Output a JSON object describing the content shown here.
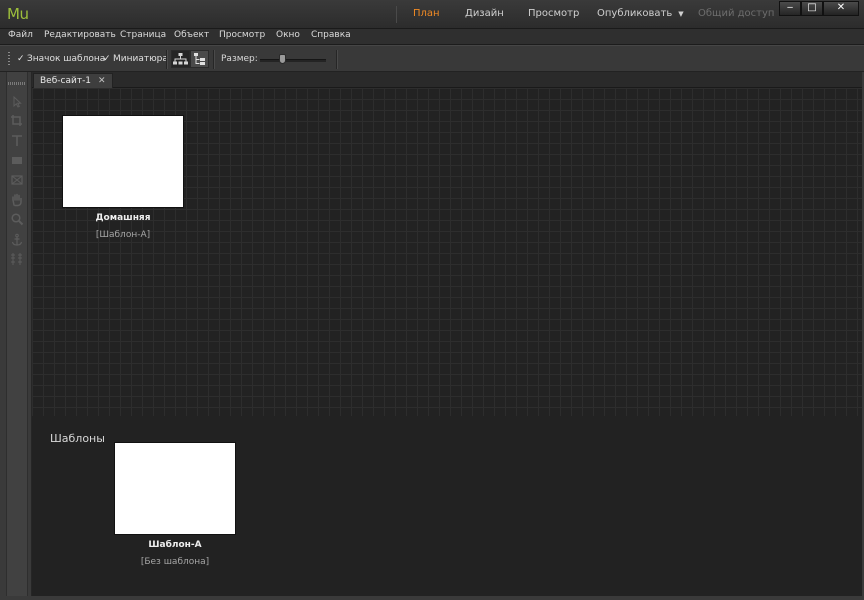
{
  "app": {
    "logo": "Mu"
  },
  "modes": [
    {
      "label": "План",
      "state": "active"
    },
    {
      "label": "Дизайн",
      "state": "normal"
    },
    {
      "label": "Просмотр",
      "state": "normal"
    },
    {
      "label": "Опубликовать",
      "state": "normal"
    },
    {
      "label": "Общий доступ",
      "state": "disabled"
    }
  ],
  "window_controls": {
    "minimize": "‒",
    "maximize": "□",
    "close": "✕"
  },
  "menu": [
    "Файл",
    "Редактировать",
    "Страница",
    "Объект",
    "Просмотр",
    "Окно",
    "Справка"
  ],
  "toolbar": {
    "show_master_label": "Значок шаблона",
    "show_master_checked": true,
    "thumbnail_label": "Миниатюра",
    "thumbnail_checked": true,
    "size_label": "Размер:",
    "size_value": 0.3
  },
  "tabs": [
    {
      "label": "Веб-сайт-1",
      "close": "✕"
    }
  ],
  "panel": {
    "arrows": "»"
  },
  "pages": [
    {
      "name": "Домашняя",
      "master": "[Шаблон-А]"
    }
  ],
  "masters_section": {
    "title": "Шаблоны",
    "items": [
      {
        "name": "Шаблон-А",
        "master": "[Без шаблона]"
      }
    ]
  },
  "colors": {
    "accent_active": "#f08a24",
    "logo": "#9dbf3c",
    "canvas_bg": "#222222"
  },
  "icons": [
    "selection-tool-icon",
    "crop-tool-icon",
    "text-tool-icon",
    "rectangle-tool-icon",
    "frame-tool-icon",
    "hand-tool-icon",
    "zoom-tool-icon",
    "anchor-tool-icon",
    "layout-tool-icon"
  ]
}
